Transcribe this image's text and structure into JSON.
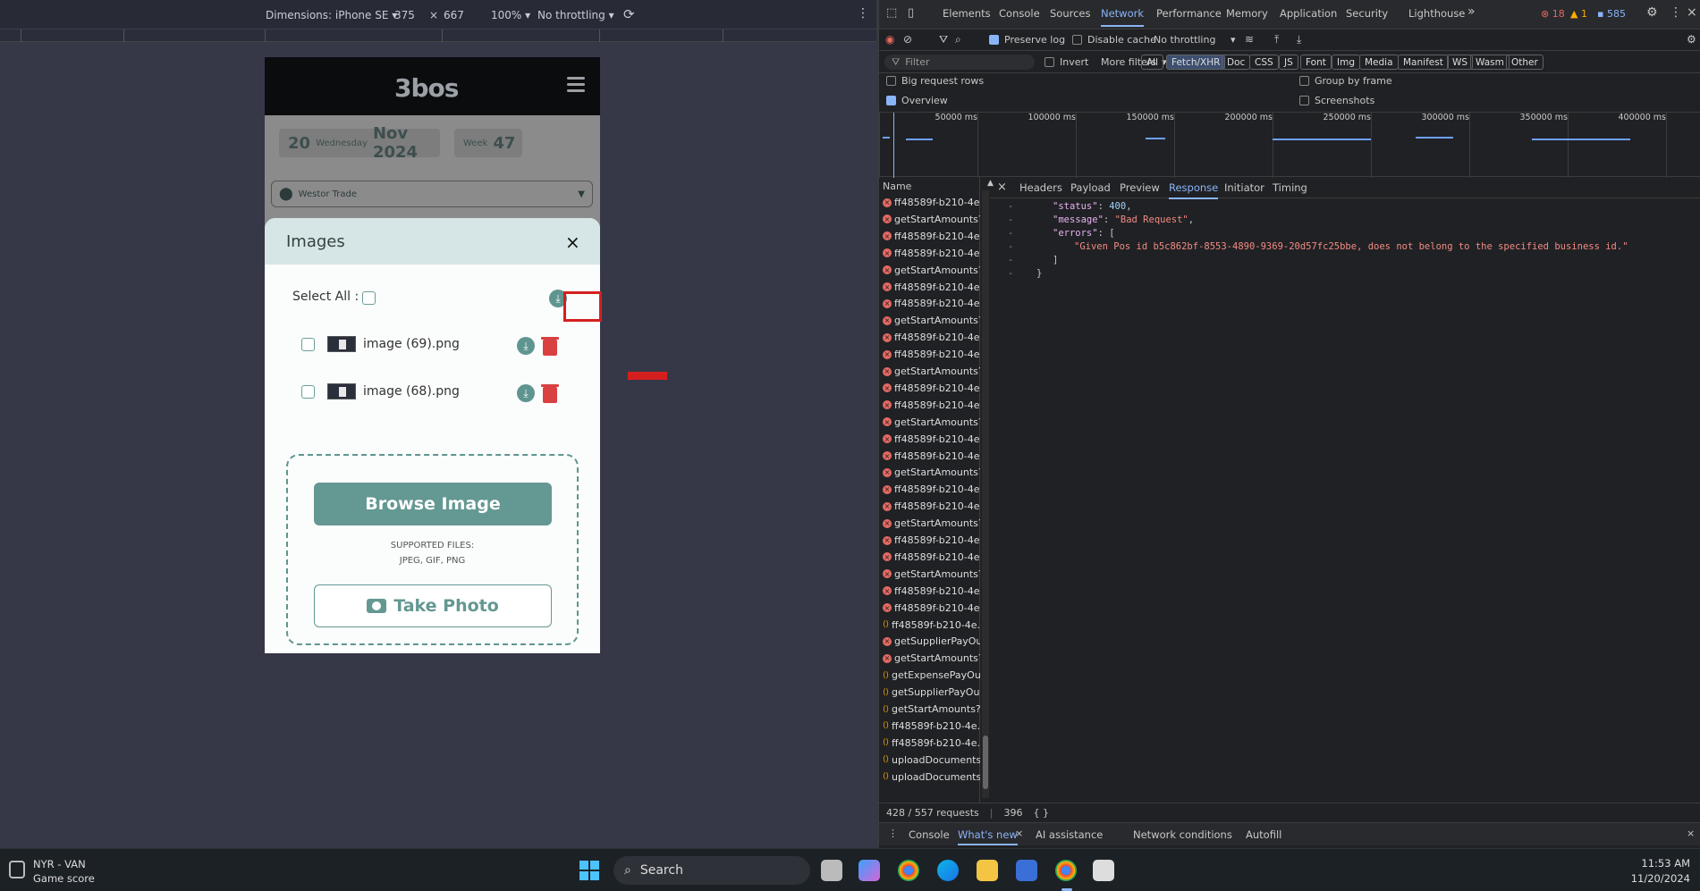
{
  "device_toolbar": {
    "dimensions_label": "Dimensions: iPhone SE",
    "width": "375",
    "times": "×",
    "height": "667",
    "zoom": "100%",
    "throttling": "No throttling"
  },
  "app": {
    "logo": "3bos",
    "date": {
      "day": "20",
      "weekday": "Wednesday",
      "month_year": "Nov 2024",
      "week_label": "Week",
      "week_num": "47"
    },
    "store": "Westor Trade"
  },
  "modal": {
    "title": "Images",
    "close": "×",
    "select_all": "Select All :",
    "files": [
      {
        "name": "image (69).png"
      },
      {
        "name": "image (68).png"
      }
    ],
    "browse_label": "Browse Image",
    "supported_line1": "SUPPORTED FILES:",
    "supported_line2": "JPEG, GIF, PNG",
    "take_photo_label": "Take Photo"
  },
  "devtools": {
    "tabs": [
      "Elements",
      "Console",
      "Sources",
      "Network",
      "Performance",
      "Memory",
      "Application",
      "Security",
      "Lighthouse"
    ],
    "active_tab": "Network",
    "more_tabs": "»",
    "errors": "18",
    "warnings": "1",
    "messages": "585",
    "preserve_log": "Preserve log",
    "disable_cache": "Disable cache",
    "throttling": "No throttling",
    "filter_placeholder": "Filter",
    "invert": "Invert",
    "more_filters": "More filters",
    "chips": [
      "All",
      "Fetch/XHR",
      "Doc",
      "CSS",
      "JS",
      "Font",
      "Img",
      "Media",
      "Manifest",
      "WS",
      "Wasm",
      "Other"
    ],
    "big_rows": "Big request rows",
    "group_frame": "Group by frame",
    "overview": "Overview",
    "screenshots": "Screenshots",
    "ticks": [
      "50000 ms",
      "100000 ms",
      "150000 ms",
      "200000 ms",
      "250000 ms",
      "300000 ms",
      "350000 ms",
      "400000 ms"
    ],
    "name_header": "Name",
    "requests": [
      {
        "t": "err",
        "name": "ff48589f-b210-4e..."
      },
      {
        "t": "err",
        "name": "getStartAmounts?..."
      },
      {
        "t": "err",
        "name": "ff48589f-b210-4e..."
      },
      {
        "t": "err",
        "name": "ff48589f-b210-4e..."
      },
      {
        "t": "err",
        "name": "getStartAmounts?..."
      },
      {
        "t": "err",
        "name": "ff48589f-b210-4e..."
      },
      {
        "t": "err",
        "name": "ff48589f-b210-4e..."
      },
      {
        "t": "err",
        "name": "getStartAmounts?..."
      },
      {
        "t": "err",
        "name": "ff48589f-b210-4e..."
      },
      {
        "t": "err",
        "name": "ff48589f-b210-4e..."
      },
      {
        "t": "err",
        "name": "getStartAmounts?..."
      },
      {
        "t": "err",
        "name": "ff48589f-b210-4e..."
      },
      {
        "t": "err",
        "name": "ff48589f-b210-4e..."
      },
      {
        "t": "err",
        "name": "getStartAmounts?..."
      },
      {
        "t": "err",
        "name": "ff48589f-b210-4e..."
      },
      {
        "t": "err",
        "name": "ff48589f-b210-4e..."
      },
      {
        "t": "err",
        "name": "getStartAmounts?..."
      },
      {
        "t": "err",
        "name": "ff48589f-b210-4e..."
      },
      {
        "t": "err",
        "name": "ff48589f-b210-4e..."
      },
      {
        "t": "err",
        "name": "getStartAmounts?..."
      },
      {
        "t": "err",
        "name": "ff48589f-b210-4e..."
      },
      {
        "t": "err",
        "name": "ff48589f-b210-4e..."
      },
      {
        "t": "err",
        "name": "getStartAmounts?..."
      },
      {
        "t": "err",
        "name": "ff48589f-b210-4e..."
      },
      {
        "t": "err",
        "name": "ff48589f-b210-4e..."
      },
      {
        "t": "xhr",
        "name": "ff48589f-b210-4e..."
      },
      {
        "t": "err",
        "name": "getSupplierPayOu..."
      },
      {
        "t": "err",
        "name": "getStartAmounts?..."
      },
      {
        "t": "xhr",
        "name": "getExpensePayOu..."
      },
      {
        "t": "xhr",
        "name": "getSupplierPayOu..."
      },
      {
        "t": "xhr",
        "name": "getStartAmounts?..."
      },
      {
        "t": "xhr",
        "name": "ff48589f-b210-4e..."
      },
      {
        "t": "xhr",
        "name": "ff48589f-b210-4e..."
      },
      {
        "t": "xhr",
        "name": "uploadDocuments"
      },
      {
        "t": "xhr",
        "name": "uploadDocuments"
      }
    ],
    "resp_tabs": [
      "Headers",
      "Payload",
      "Preview",
      "Response",
      "Initiator",
      "Timing"
    ],
    "active_resp_tab": "Response",
    "response": {
      "status_key": "\"status\"",
      "status_val": "400",
      "message_key": "\"message\"",
      "message_val": "\"Bad Request\"",
      "errors_key": "\"errors\"",
      "error_msg": "\"Given Pos id b5c862bf-8553-4890-9369-20d57fc25bbe, does not belong to the specified business id.\""
    },
    "req_count": "428 / 557 requests",
    "transferred": "396",
    "drawer_tabs": [
      "Console",
      "What's new",
      "AI assistance",
      "Network conditions",
      "Autofill"
    ],
    "active_drawer": "What's new"
  },
  "taskbar": {
    "game_title": "NYR - VAN",
    "game_sub": "Game score",
    "search": "Search",
    "time": "11:53 AM",
    "date": "11/20/2024"
  }
}
